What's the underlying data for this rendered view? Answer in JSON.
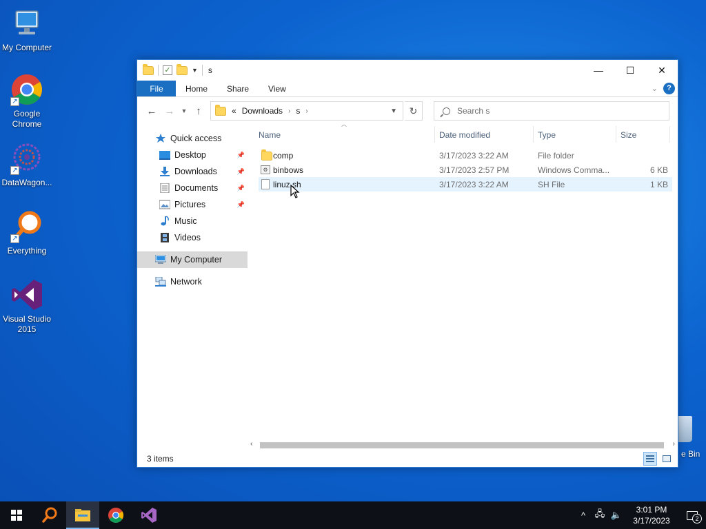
{
  "desktop": {
    "icons": [
      {
        "label": "My Computer"
      },
      {
        "label": "Google Chrome"
      },
      {
        "label": "DataWagon..."
      },
      {
        "label": "Everything"
      },
      {
        "label": "Visual Studio 2015"
      }
    ],
    "recycle_bin_partial_label": "e Bin"
  },
  "window": {
    "title": "s",
    "controls": {
      "minimize": "—",
      "maximize": "☐",
      "close": "✕"
    },
    "ribbon": {
      "tabs": [
        {
          "label": "File"
        },
        {
          "label": "Home"
        },
        {
          "label": "Share"
        },
        {
          "label": "View"
        }
      ],
      "help": "?"
    },
    "address": {
      "overflow": "«",
      "crumbs": [
        "Downloads",
        "s"
      ]
    },
    "search": {
      "placeholder": "Search s"
    },
    "nav_pane": {
      "quick_access": "Quick access",
      "pinned": [
        {
          "label": "Desktop",
          "pinned": true
        },
        {
          "label": "Downloads",
          "pinned": true
        },
        {
          "label": "Documents",
          "pinned": true
        },
        {
          "label": "Pictures",
          "pinned": true
        },
        {
          "label": "Music",
          "pinned": false
        },
        {
          "label": "Videos",
          "pinned": false
        }
      ],
      "my_computer": "My Computer",
      "network": "Network"
    },
    "columns": {
      "name": "Name",
      "date_modified": "Date modified",
      "type": "Type",
      "size": "Size"
    },
    "files": [
      {
        "name": "comp",
        "date": "3/17/2023 3:22 AM",
        "type": "File folder",
        "size": "",
        "icon": "folder-icon"
      },
      {
        "name": "binbows",
        "date": "3/17/2023 2:57 PM",
        "type": "Windows Comma...",
        "size": "6 KB",
        "icon": "cmd-file-icon"
      },
      {
        "name": "linuz.sh",
        "date": "3/17/2023 3:22 AM",
        "type": "SH File",
        "size": "1 KB",
        "icon": "file-icon"
      }
    ],
    "status": {
      "item_count": "3 items"
    }
  },
  "taskbar": {
    "clock_time": "3:01 PM",
    "clock_date": "3/17/2023",
    "notification_count": "2"
  },
  "colors": {
    "accent": "#1a6fc2",
    "desktop_bg": "#0c63cf",
    "taskbar_bg": "#0d1117",
    "hover_row": "#e5f3ff"
  }
}
